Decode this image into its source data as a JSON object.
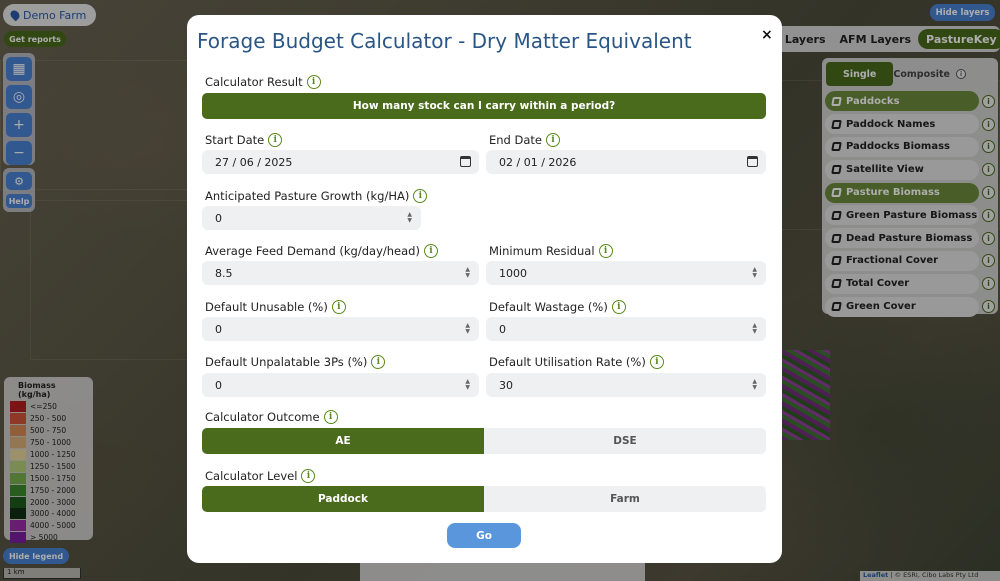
{
  "map": {
    "farm_name": "Demo Farm",
    "get_reports": "Get reports",
    "help": "Help",
    "hide_layers": "Hide layers",
    "hide_legend": "Hide legend",
    "scale": "1 km",
    "attribution_link": "Leaflet",
    "attribution_text": "| © ESRI, Cibo Labs Pty Ltd"
  },
  "layer_tabs": [
    {
      "label": "se Layers",
      "active": false
    },
    {
      "label": "AFM Layers",
      "active": false
    },
    {
      "label": "PastureKey",
      "active": true
    }
  ],
  "layer_panel": {
    "modes": [
      {
        "label": "Single",
        "active": true
      },
      {
        "label": "Composite",
        "active": false
      }
    ],
    "layers": [
      {
        "label": "Paddocks",
        "active": true
      },
      {
        "label": "Paddock Names",
        "active": false
      },
      {
        "label": "Paddocks Biomass",
        "active": false
      },
      {
        "label": "Satellite View",
        "active": false
      },
      {
        "label": "Pasture Biomass",
        "active": true
      },
      {
        "label": "Green Pasture Biomass",
        "active": false
      },
      {
        "label": "Dead Pasture Biomass",
        "active": false
      },
      {
        "label": "Fractional Cover",
        "active": false
      },
      {
        "label": "Total Cover",
        "active": false
      },
      {
        "label": "Green Cover",
        "active": false
      }
    ]
  },
  "legend": {
    "title": "Biomass (kg/ha)",
    "items": [
      {
        "label": "<=250",
        "color": "#b41f1f"
      },
      {
        "label": "250 - 500",
        "color": "#d2553a"
      },
      {
        "label": "500 - 750",
        "color": "#d88b52"
      },
      {
        "label": "750 - 1000",
        "color": "#d8b07a"
      },
      {
        "label": "1000 - 1250",
        "color": "#e8d6a0"
      },
      {
        "label": "1250 - 1500",
        "color": "#b5cf7a"
      },
      {
        "label": "1500 - 1750",
        "color": "#79b04e"
      },
      {
        "label": "1750 - 2000",
        "color": "#3c8a2e"
      },
      {
        "label": "2000 - 3000",
        "color": "#1e5a1e"
      },
      {
        "label": "3000 - 4000",
        "color": "#0f2e12"
      },
      {
        "label": "4000 - 5000",
        "color": "#9a2aa8"
      },
      {
        "label": "> 5000",
        "color": "#7a1ea0"
      }
    ]
  },
  "modal": {
    "title": "Forage Budget Calculator - Dry Matter Equivalent",
    "close": "×",
    "calculator_result_label": "Calculator Result",
    "calculator_result_value": "How many stock can I carry within a period?",
    "start_date_label": "Start Date",
    "start_date": "27 / 06 / 2025",
    "end_date_label": "End Date",
    "end_date": "02 / 01 / 2026",
    "pasture_growth_label": "Anticipated Pasture Growth (kg/HA)",
    "pasture_growth": "0",
    "feed_demand_label": "Average Feed Demand (kg/day/head)",
    "feed_demand": "8.5",
    "min_residual_label": "Minimum Residual",
    "min_residual": "1000",
    "unusable_label": "Default Unusable (%)",
    "unusable": "0",
    "wastage_label": "Default Wastage (%)",
    "wastage": "0",
    "unpalatable_label": "Default Unpalatable 3Ps (%)",
    "unpalatable": "0",
    "utilisation_label": "Default Utilisation Rate (%)",
    "utilisation": "30",
    "outcome_label": "Calculator Outcome",
    "outcome_options": [
      {
        "label": "AE",
        "active": true
      },
      {
        "label": "DSE",
        "active": false
      }
    ],
    "level_label": "Calculator Level",
    "level_options": [
      {
        "label": "Paddock",
        "active": true
      },
      {
        "label": "Farm",
        "active": false
      }
    ],
    "go": "Go"
  }
}
